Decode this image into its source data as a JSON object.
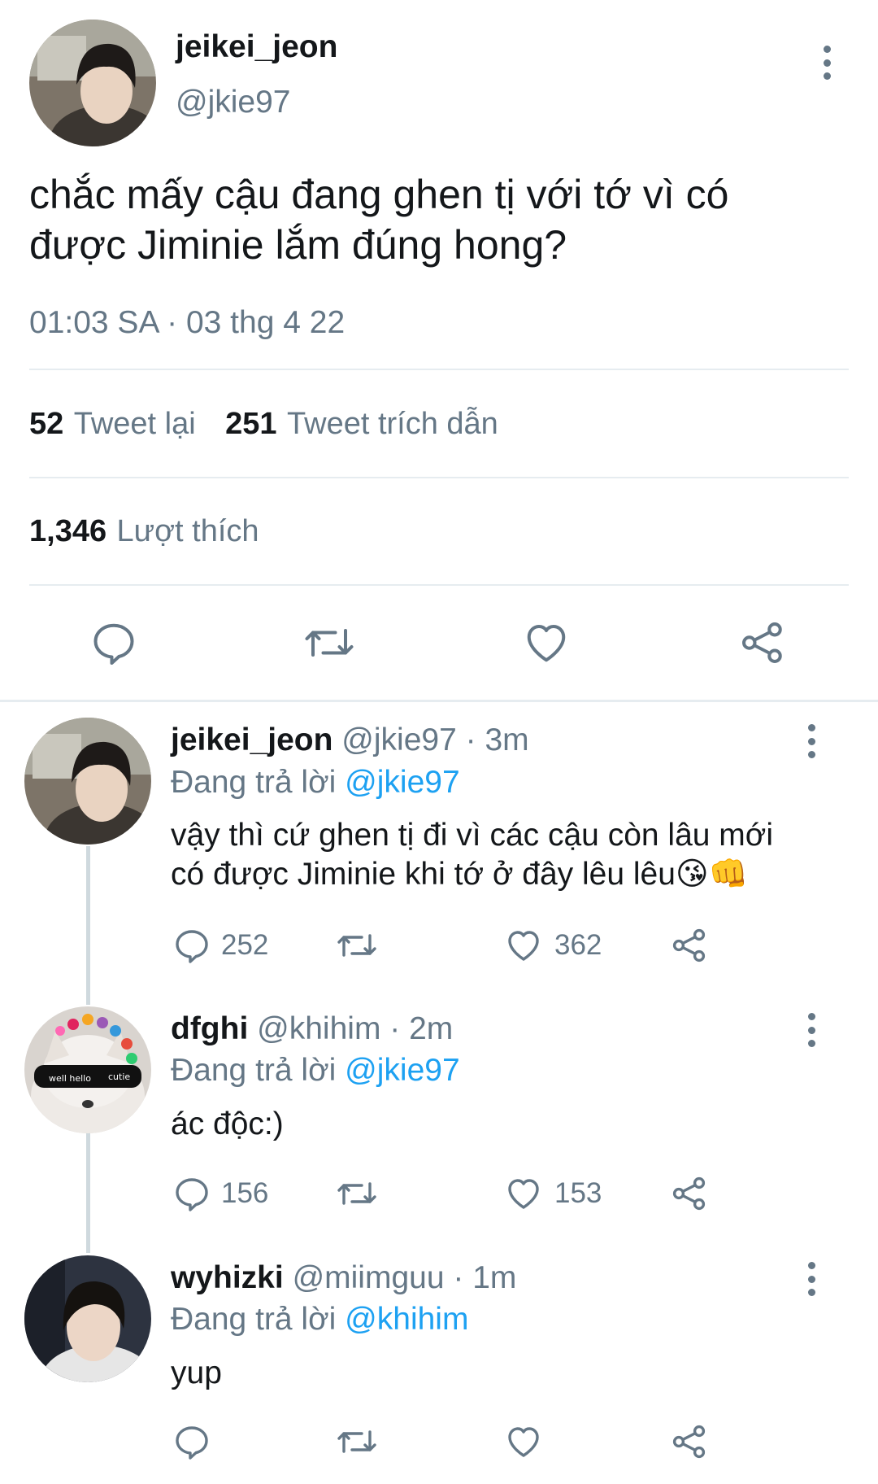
{
  "main_tweet": {
    "display_name": "jeikei_jeon",
    "handle": "@jkie97",
    "text_line1": "chắc mấy cậu đang ghen tị với tớ vì có",
    "text_line2": "được Jiminie lắm đúng hong?",
    "timestamp": "01:03 SA · 03 thg 4 22",
    "retweets_count": "52",
    "retweets_label": "Tweet lại",
    "quotes_count": "251",
    "quotes_label": "Tweet trích dẫn",
    "likes_count": "1,346",
    "likes_label": "Lượt thích"
  },
  "replies": [
    {
      "display_name": "jeikei_jeon",
      "handle": "@jkie97",
      "time": "· 3m",
      "replying_prefix": "Đang trả lời",
      "replying_to": "@jkie97",
      "text_line1": "vậy thì cứ ghen tị đi vì các cậu còn lâu mới",
      "text_line2": "có được Jiminie khi tớ ở đây lêu lêu😘👊",
      "reply_count": "252",
      "retweet_count": "",
      "like_count": "362"
    },
    {
      "display_name": "dfghi",
      "handle": "@khihim",
      "time": "· 2m",
      "replying_prefix": "Đang trả lời",
      "replying_to": "@jkie97",
      "text_line1": "ác độc:)",
      "reply_count": "156",
      "retweet_count": "",
      "like_count": "153"
    },
    {
      "display_name": "wyhizki",
      "handle": "@miimguu",
      "time": "· 1m",
      "replying_prefix": "Đang trả lời",
      "replying_to": "@khihim",
      "text_line1": "yup",
      "reply_count": "",
      "retweet_count": "",
      "like_count": ""
    }
  ],
  "avatar_text": {
    "well_hello": "well hello",
    "cutie": "cutie"
  },
  "colors": {
    "accent": "#1da1f2",
    "secondary_text": "#657786",
    "divider": "#e6ecf0"
  },
  "icons": [
    "reply-icon",
    "retweet-icon",
    "like-icon",
    "share-icon",
    "more-icon"
  ]
}
